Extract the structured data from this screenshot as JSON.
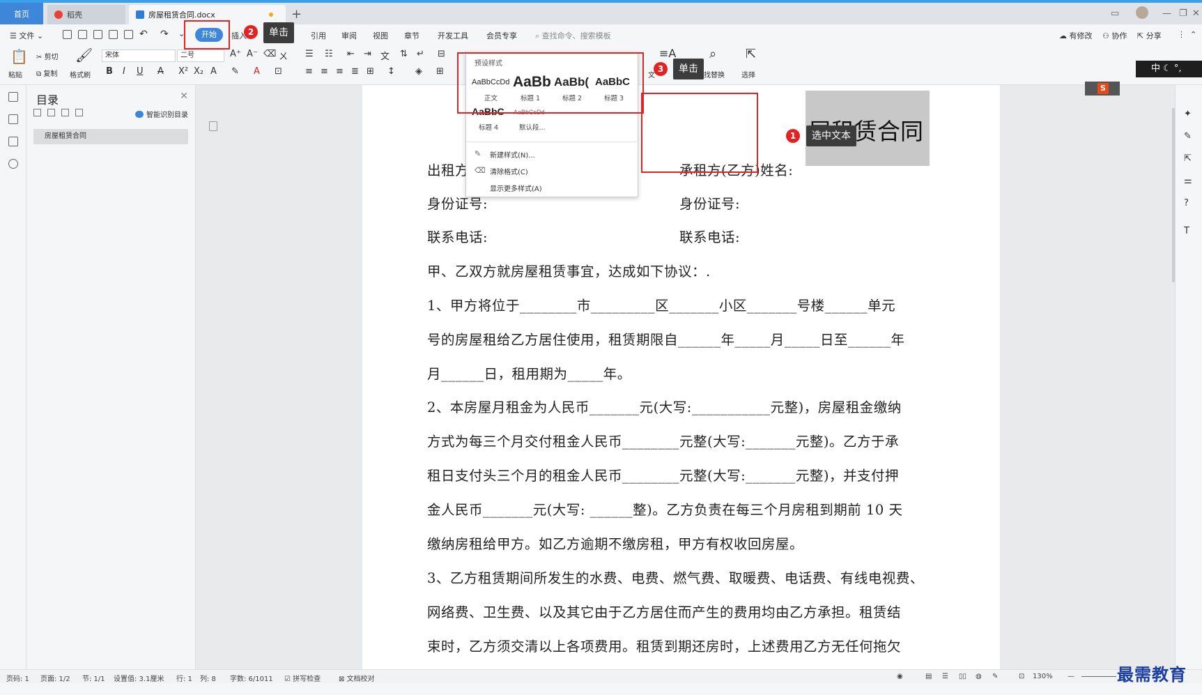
{
  "tabs": {
    "home": "首页",
    "daoke": "稻壳",
    "doc": "房屋租赁合同.docx"
  },
  "menu": {
    "file": "文件",
    "start": "开始",
    "insert": "插入",
    "reference": "引用",
    "review": "审阅",
    "view": "视图",
    "section": "章节",
    "devtools": "开发工具",
    "member": "会员专享",
    "search_placeholder": "查找命令、搜索模板",
    "modified": "有修改",
    "collab": "协作",
    "share": "分享"
  },
  "ribbon": {
    "paste": "粘贴",
    "cut": "剪切",
    "copy": "复制",
    "format_painter": "格式刷",
    "font_name": "宋体",
    "font_size": "二号",
    "text_tool": "文",
    "find_replace": "查找替换",
    "select": "选择"
  },
  "style_gallery": {
    "header": "预设样式",
    "samples": [
      {
        "sample": "AaBbCcDd",
        "caption": "正文"
      },
      {
        "sample": "AaBb",
        "caption": "标题 1"
      },
      {
        "sample": "AaBb(",
        "caption": "标题 2"
      },
      {
        "sample": "AaBbC",
        "caption": "标题 3"
      },
      {
        "sample": "AaBbC",
        "caption": "标题 4"
      },
      {
        "sample": "AaBbCcDd",
        "caption": "默认段..."
      }
    ],
    "menu": [
      {
        "icon": "new-style-icon",
        "label": "新建样式(N)..."
      },
      {
        "icon": "clear-format-icon",
        "label": "清除格式(C)"
      },
      {
        "icon": "",
        "label": "显示更多样式(A)"
      }
    ]
  },
  "annotations": {
    "tip1": "选中文本",
    "tip2": "单击",
    "tip3": "单击",
    "badge1": "1",
    "badge2": "2",
    "badge3": "3"
  },
  "toc": {
    "title": "目录",
    "smart": "智能识别目录",
    "items": [
      "房屋租赁合同"
    ]
  },
  "document": {
    "title": "屋租赁合同",
    "lines": [
      {
        "left": "出租方",
        "right": "承租方(乙方)姓名:"
      },
      {
        "left": "身份证号:",
        "right": "身份证号:"
      },
      {
        "left": "联系电话:",
        "right": "联系电话:"
      }
    ],
    "paragraphs": [
      "甲、乙双方就房屋租赁事宜，达成如下协议：.",
      "1、甲方将位于________市_________区_______小区_______号楼______单元",
      "号的房屋租给乙方居住使用，租赁期限自______年_____月_____日至______年",
      "月______日，租用期为_____年。",
      "2、本房屋月租金为人民币_______元(大写:___________元整)，房屋租金缴纳",
      "方式为每三个月交付租金人民币________元整(大写:_______元整)。乙方于承",
      "租日支付头三个月的租金人民币________元整(大写:_______元整)，并支付押",
      "金人民币_______元(大写: ______整)。乙方负责在每三个月房租到期前 10 天",
      "缴纳房租给甲方。如乙方逾期不缴房租，甲方有权收回房屋。",
      "3、乙方租赁期间所发生的水费、电费、燃气费、取暖费、电话费、有线电视费、",
      "网络费、卫生费、以及其它由于乙方居住而产生的费用均由乙方承担。租赁结",
      "束时，乙方须交清以上各项费用。租赁到期还房时，上述费用乙方无任何拖欠"
    ]
  },
  "statusbar": {
    "page_num": "页码: 1",
    "pages": "页面: 1/2",
    "section": "节: 1/1",
    "setting": "设置值: 3.1厘米",
    "row": "行: 1",
    "col": "列: 8",
    "words": "字数: 6/1011",
    "spell": "拼写检查",
    "proof": "文档校对",
    "zoom": "130%"
  },
  "ime": {
    "label": "中"
  },
  "watermark": "最需教育"
}
